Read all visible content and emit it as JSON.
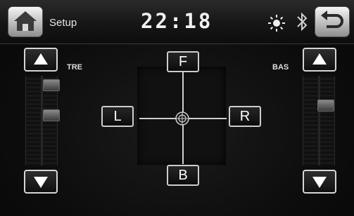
{
  "header": {
    "title": "Setup",
    "clock": "22:18",
    "home_icon": "home-icon",
    "back_icon": "return-arrow-icon",
    "brightness_icon": "sun-icon",
    "bluetooth_icon": "bluetooth-icon"
  },
  "treble": {
    "label": "TRE",
    "up_icon": "triangle-up-icon",
    "down_icon": "triangle-down-icon"
  },
  "bass": {
    "label": "BAS",
    "up_icon": "triangle-up-icon",
    "down_icon": "triangle-down-icon"
  },
  "fader": {
    "front_label": "F",
    "back_label": "B",
    "left_label": "L",
    "right_label": "R",
    "center_icon": "crosshair-target-icon"
  },
  "colors": {
    "background": "#0d0d0d",
    "button_border": "#d6d6d6",
    "top_button_face": "#c9c9c9"
  }
}
